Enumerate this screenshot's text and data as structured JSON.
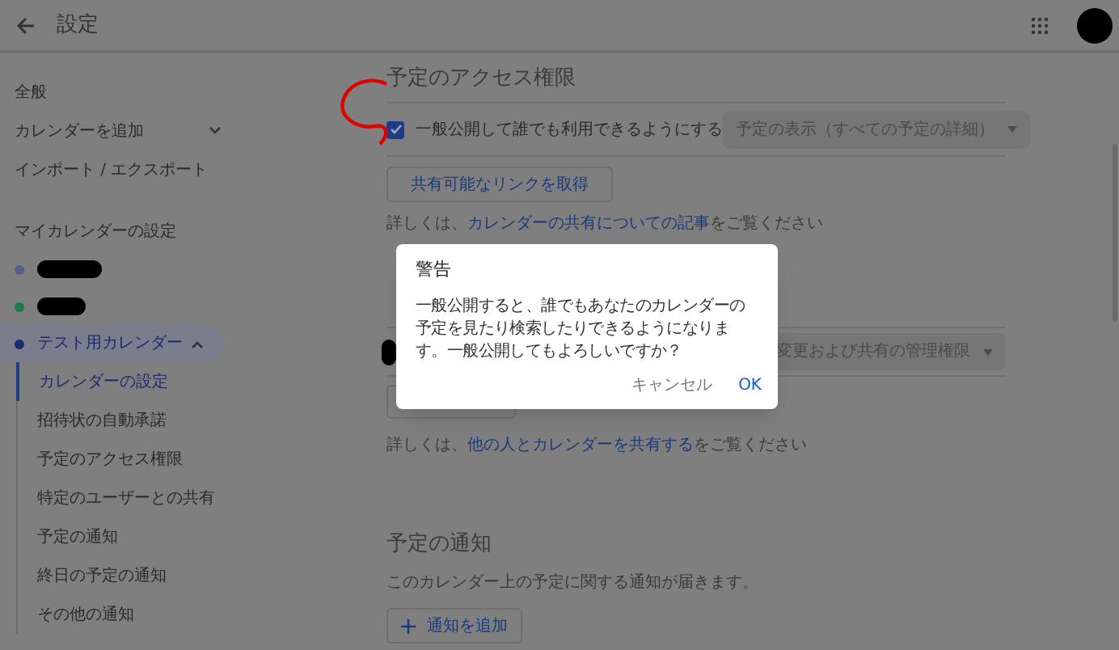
{
  "header": {
    "title": "設定"
  },
  "sidebar": {
    "items": [
      {
        "label": "全般"
      },
      {
        "label": "カレンダーを追加",
        "expanded": false
      },
      {
        "label": "インポート / エクスポート"
      }
    ],
    "section_title": "マイカレンダーの設定",
    "calendars": [
      {
        "kind": "redacted",
        "color": "#555d8a"
      },
      {
        "kind": "redacted",
        "color": "#1f7a4a"
      },
      {
        "kind": "named",
        "label": "テスト用カレンダー",
        "color": "#1e2a6e",
        "expanded": true,
        "selected": true,
        "children": [
          {
            "label": "カレンダーの設定",
            "selected": true
          },
          {
            "label": "招待状の自動承諾",
            "selected": false
          },
          {
            "label": "予定のアクセス権限",
            "selected": false
          },
          {
            "label": "特定のユーザーとの共有",
            "selected": false
          },
          {
            "label": "予定の通知",
            "selected": false
          },
          {
            "label": "終日の予定の通知",
            "selected": false
          },
          {
            "label": "その他の通知",
            "selected": false
          }
        ]
      }
    ]
  },
  "access": {
    "title": "予定のアクセス権限",
    "checkbox": {
      "label": "一般公開して誰でも利用できるようにする",
      "checked": true
    },
    "dropdown": "予定の表示（すべての予定の詳細）",
    "link_button": "共有可能なリンクを取得",
    "help": {
      "prefix": "詳しくは、",
      "link": "カレンダーの共有についての記事",
      "suffix": "をご覧ください"
    }
  },
  "sharing": {
    "user": {
      "kind": "redacted"
    },
    "dropdown": "変更および共有の管理権限",
    "help": {
      "prefix": "詳しくは、",
      "link": "他の人とカレンダーを共有する",
      "suffix": "をご覧ください"
    }
  },
  "notifications": {
    "title": "予定の通知",
    "description": "このカレンダー上の予定に関する通知が届きます。",
    "add_button": "通知を追加"
  },
  "dialog": {
    "title": "警告",
    "message": "一般公開すると、誰でもあなたのカレンダーの予定を見たり検索したりできるようになります。一般公開してもよろしいですか？",
    "buttons": [
      {
        "label": "キャンセル",
        "kind": "secondary"
      },
      {
        "label": "OK",
        "kind": "primary"
      }
    ]
  }
}
